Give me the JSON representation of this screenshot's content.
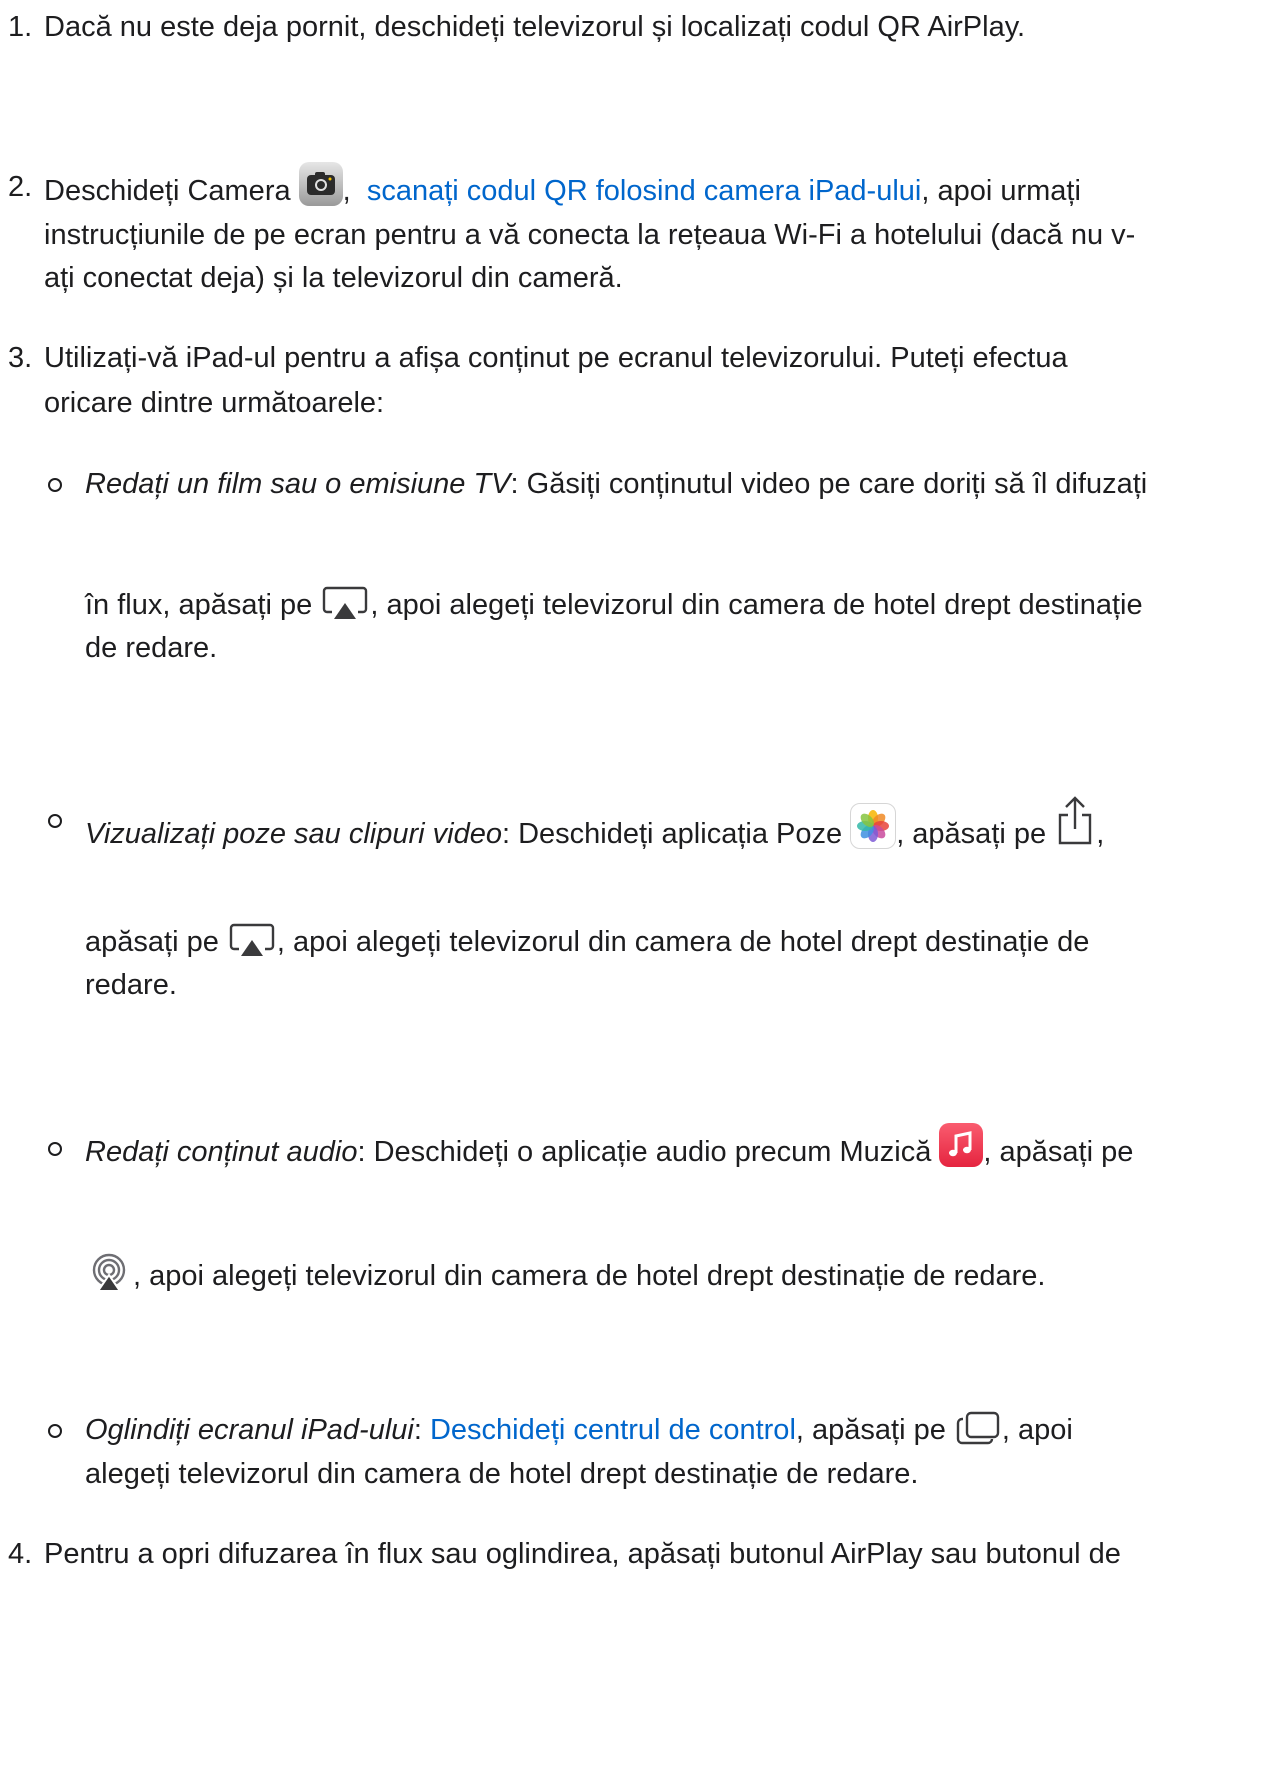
{
  "steps": [
    {
      "num": "1.",
      "text": "Dacă nu este deja pornit, deschideți televizorul și localizați codul QR AirPlay."
    },
    {
      "num": "2.",
      "before_icon": "Deschideți Camera",
      "icon": "camera-app-icon",
      "link": "scanați codul QR folosind camera iPad-ului",
      "after_link": ", apoi urmați",
      "line2": "instrucțiunile de pe ecran pentru a vă conecta la rețeaua Wi-Fi a hotelului (dacă nu v-",
      "line3": "ați conectat deja) și la televizorul din cameră."
    },
    {
      "num": "3.",
      "line1": "Utilizați-vă iPad-ul pentru a afișa conținut pe ecranul televizorului. Puteți efectua",
      "line2": "oricare dintre următoarele:",
      "options": [
        {
          "title": "Redați un film sau o emisiune TV",
          "line1_rest": ": Găsiți conținutul video pe care doriți să îl difuzați",
          "line2_pre": "în flux, apăsați pe",
          "icon": "airplay-video-icon",
          "line2_post": ", apoi alegeți televizorul din camera de hotel drept destinație",
          "line3": "de redare."
        },
        {
          "title": "Vizualizați poze sau clipuri video",
          "line1_rest": ": Deschideți aplicația Poze",
          "app_icon": "photos-app-icon",
          "line1_mid": ", apăsați pe",
          "share_icon": "share-icon",
          "line1_end": ",",
          "line2_pre": "apăsați pe",
          "icon": "airplay-video-icon",
          "line2_post": ", apoi alegeți televizorul din camera de hotel drept destinație de",
          "line3": "redare."
        },
        {
          "title": "Redați conținut audio",
          "line1_rest": ": Deschideți o aplicație audio precum Muzică",
          "app_icon": "music-app-icon",
          "line1_end": ", apăsați pe",
          "icon": "airplay-audio-icon",
          "line2_post": ", apoi alegeți televizorul din camera de hotel drept destinație de redare."
        },
        {
          "title": "Oglindiți ecranul iPad-ului",
          "colon": ":",
          "link": "Deschideți centrul de control",
          "line1_mid": ", apăsați pe",
          "icon": "screen-mirroring-icon",
          "line1_end": ", apoi",
          "line2": "alegeți televizorul din camera de hotel drept destinație de redare."
        }
      ]
    },
    {
      "num": "4.",
      "text": "Pentru a opri difuzarea în flux sau oglindirea, apăsați butonul AirPlay sau butonul de"
    }
  ],
  "colors": {
    "text": "#1d1d1f",
    "link": "#0066cc"
  }
}
